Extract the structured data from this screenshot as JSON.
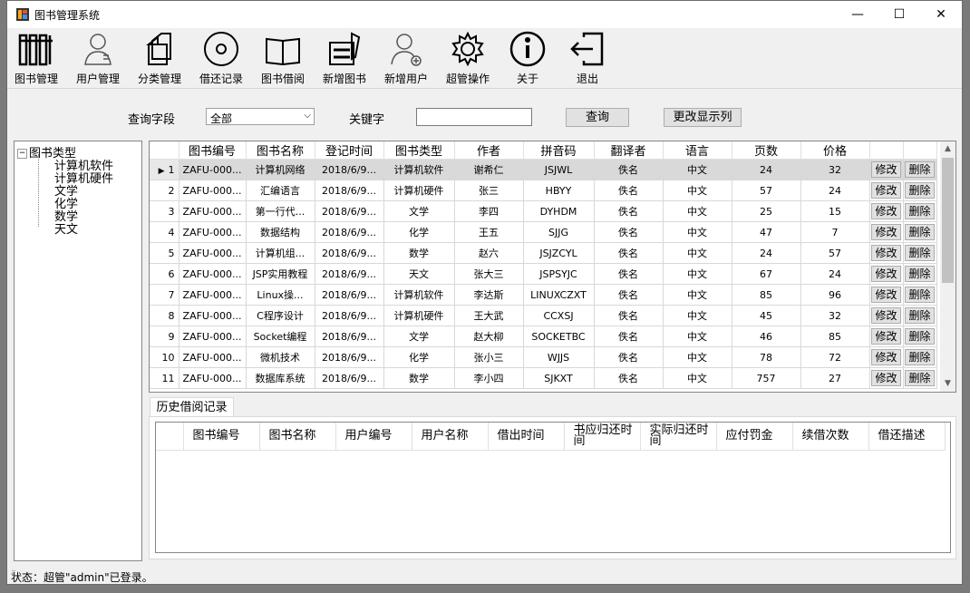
{
  "window": {
    "title": "图书管理系统",
    "minimize": "—",
    "maximize": "☐",
    "close": "✕"
  },
  "toolbar": [
    {
      "label": "图书管理",
      "icon": "books-icon"
    },
    {
      "label": "用户管理",
      "icon": "user-icon"
    },
    {
      "label": "分类管理",
      "icon": "copy-icon"
    },
    {
      "label": "借还记录",
      "icon": "disc-icon"
    },
    {
      "label": "图书借阅",
      "icon": "open-book-icon"
    },
    {
      "label": "新增图书",
      "icon": "add-book-icon"
    },
    {
      "label": "新增用户",
      "icon": "add-user-icon"
    },
    {
      "label": "超管操作",
      "icon": "gear-icon"
    },
    {
      "label": "关于",
      "icon": "info-icon"
    },
    {
      "label": "退出",
      "icon": "exit-icon"
    }
  ],
  "query": {
    "field_label": "查询字段",
    "field_value": "全部",
    "keyword_label": "关键字",
    "keyword_value": "",
    "search_button": "查询",
    "columns_button": "更改显示列"
  },
  "tree": {
    "root": "图书类型",
    "children": [
      "计算机软件",
      "计算机硬件",
      "文学",
      "化学",
      "数学",
      "天文"
    ]
  },
  "grid": {
    "columns": [
      "图书编号",
      "图书名称",
      "登记时间",
      "图书类型",
      "作者",
      "拼音码",
      "翻译者",
      "语言",
      "页数",
      "价格"
    ],
    "edit_label": "修改",
    "delete_label": "删除",
    "rows": [
      [
        "1",
        "ZAFU-000...",
        "计算机网络",
        "2018/6/9...",
        "计算机软件",
        "谢希仁",
        "JSJWL",
        "佚名",
        "中文",
        "24",
        "32"
      ],
      [
        "2",
        "ZAFU-000...",
        "汇编语言",
        "2018/6/9...",
        "计算机硬件",
        "张三",
        "HBYY",
        "佚名",
        "中文",
        "57",
        "24"
      ],
      [
        "3",
        "ZAFU-000...",
        "第一行代...",
        "2018/6/9...",
        "文学",
        "李四",
        "DYHDM",
        "佚名",
        "中文",
        "25",
        "15"
      ],
      [
        "4",
        "ZAFU-000...",
        "数据结构",
        "2018/6/9...",
        "化学",
        "王五",
        "SJJG",
        "佚名",
        "中文",
        "47",
        "7"
      ],
      [
        "5",
        "ZAFU-000...",
        "计算机组...",
        "2018/6/9...",
        "数学",
        "赵六",
        "JSJZCYL",
        "佚名",
        "中文",
        "24",
        "57"
      ],
      [
        "6",
        "ZAFU-000...",
        "JSP实用教程",
        "2018/6/9...",
        "天文",
        "张大三",
        "JSPSYJC",
        "佚名",
        "中文",
        "67",
        "24"
      ],
      [
        "7",
        "ZAFU-000...",
        "Linux操...",
        "2018/6/9...",
        "计算机软件",
        "李达斯",
        "LINUXCZXT",
        "佚名",
        "中文",
        "85",
        "96"
      ],
      [
        "8",
        "ZAFU-000...",
        "C程序设计",
        "2018/6/9...",
        "计算机硬件",
        "王大武",
        "CCXSJ",
        "佚名",
        "中文",
        "45",
        "32"
      ],
      [
        "9",
        "ZAFU-000...",
        "Socket编程",
        "2018/6/9...",
        "文学",
        "赵大柳",
        "SOCKETBC",
        "佚名",
        "中文",
        "46",
        "85"
      ],
      [
        "10",
        "ZAFU-000...",
        "微机技术",
        "2018/6/9...",
        "化学",
        "张小三",
        "WJJS",
        "佚名",
        "中文",
        "78",
        "72"
      ],
      [
        "11",
        "ZAFU-000...",
        "数据库系统",
        "2018/6/9...",
        "数学",
        "李小四",
        "SJKXT",
        "佚名",
        "中文",
        "757",
        "27"
      ]
    ]
  },
  "history": {
    "tab": "历史借阅记录",
    "columns": [
      "图书编号",
      "图书名称",
      "用户编号",
      "用户名称",
      "借出时间",
      "书应归还时间",
      "实际归还时间",
      "应付罚金",
      "续借次数",
      "借还描述"
    ]
  },
  "status": "状态：超管\"admin\"已登录。"
}
